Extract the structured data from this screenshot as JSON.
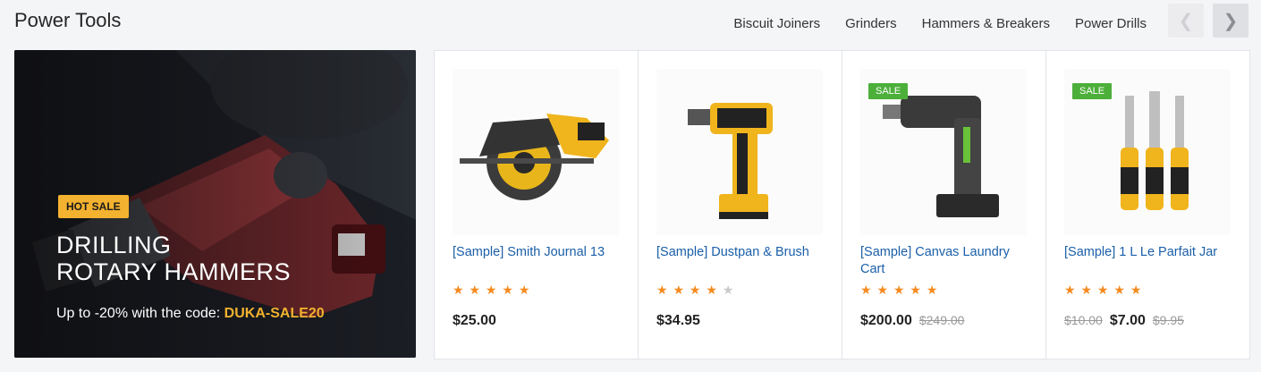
{
  "section": {
    "title": "Power Tools",
    "tabs": [
      "Biscuit Joiners",
      "Grinders",
      "Hammers & Breakers",
      "Power Drills"
    ],
    "prev_icon": "chevron-left-icon",
    "next_icon": "chevron-right-icon"
  },
  "banner": {
    "badge": "HOT SALE",
    "heading_line1": "DRILLING",
    "heading_line2": "ROTARY HAMMERS",
    "subtitle": "Up to -20% with the code:",
    "code": "DUKA-SALE20"
  },
  "products": [
    {
      "name": "[Sample] Smith Journal 13",
      "rating": 5,
      "price": "$25.00",
      "sale_badge": ""
    },
    {
      "name": "[Sample] Dustpan & Brush",
      "rating": 4,
      "price": "$34.95",
      "sale_badge": ""
    },
    {
      "name": "[Sample] Canvas Laundry Cart",
      "rating": 5,
      "price": "$200.00",
      "old_price": "$249.00",
      "sale_badge": "SALE"
    },
    {
      "name": "[Sample] 1 L Le Parfait Jar",
      "rating": 5,
      "old_price_before": "$10.00",
      "price": "$7.00",
      "old_price": "$9.95",
      "sale_badge": "SALE"
    }
  ],
  "colors": {
    "accent_yellow": "#f3b22f",
    "link_blue": "#1a5fa8",
    "star_orange": "#f58a1f",
    "sale_green": "#4caf3a"
  }
}
